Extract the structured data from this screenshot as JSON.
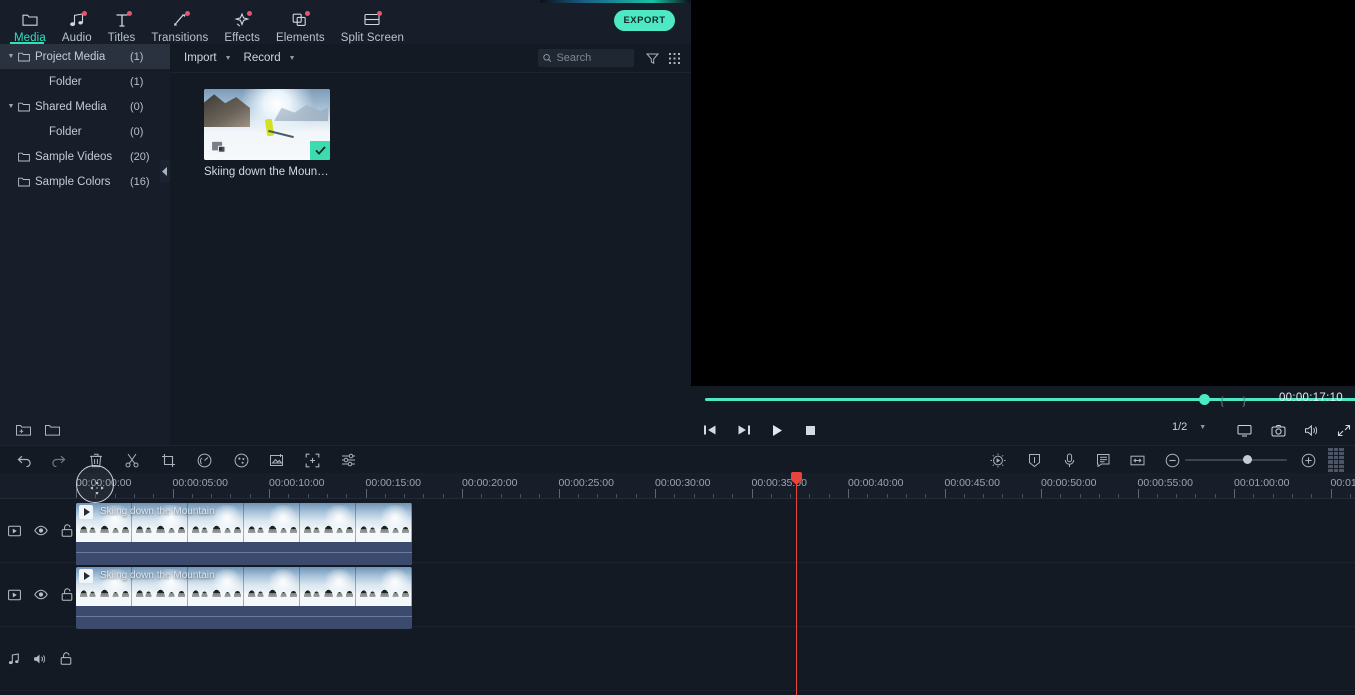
{
  "nav": {
    "items": [
      {
        "label": "Media",
        "icon": "folder-icon",
        "active": true,
        "dot": false
      },
      {
        "label": "Audio",
        "icon": "music-note-icon",
        "active": false,
        "dot": true
      },
      {
        "label": "Titles",
        "icon": "text-t-icon",
        "active": false,
        "dot": true
      },
      {
        "label": "Transitions",
        "icon": "transition-icon",
        "active": false,
        "dot": true
      },
      {
        "label": "Effects",
        "icon": "sparkle-star-icon",
        "active": false,
        "dot": true
      },
      {
        "label": "Elements",
        "icon": "shapes-icon",
        "active": false,
        "dot": true
      },
      {
        "label": "Split Screen",
        "icon": "split-screen-icon",
        "active": false,
        "dot": true
      }
    ]
  },
  "export": {
    "label": "EXPORT"
  },
  "library": {
    "tree": [
      {
        "label": "Project Media",
        "count": "(1)",
        "caret": "▼",
        "indent": false,
        "selected": true
      },
      {
        "label": "Folder",
        "count": "(1)",
        "caret": "",
        "indent": true,
        "selected": false
      },
      {
        "label": "Shared Media",
        "count": "(0)",
        "caret": "▼",
        "indent": false,
        "selected": false
      },
      {
        "label": "Folder",
        "count": "(0)",
        "caret": "",
        "indent": true,
        "selected": false
      },
      {
        "label": "Sample Videos",
        "count": "(20)",
        "caret": "",
        "indent": false,
        "selected": false
      },
      {
        "label": "Sample Colors",
        "count": "(16)",
        "caret": "",
        "indent": false,
        "selected": false
      }
    ],
    "footer_icons": [
      "new-folder-icon",
      "open-folder-icon"
    ],
    "collapse_icon": "collapse-panel-icon"
  },
  "media_toolbar": {
    "import_label": "Import",
    "record_label": "Record",
    "search_placeholder": "Search",
    "search_value": "",
    "filter_icon": "filter-funnel-icon",
    "view_icon": "grid-view-icon"
  },
  "media_items": [
    {
      "name": "Skiing down the Mountain",
      "selected": true,
      "badge": "pip-icon"
    }
  ],
  "player": {
    "timecode": "00:00:17:10",
    "progress_percent": 100,
    "mark_in": "{",
    "mark_out": "}",
    "ratio_label": "1/2",
    "controls": [
      {
        "name": "prev-frame-button",
        "icon": "prev-frame-icon"
      },
      {
        "name": "next-frame-button",
        "icon": "next-frame-icon"
      },
      {
        "name": "play-button",
        "icon": "play-icon"
      },
      {
        "name": "stop-button",
        "icon": "stop-icon"
      }
    ],
    "right_controls": [
      {
        "name": "display-settings-button",
        "icon": "monitor-icon"
      },
      {
        "name": "snapshot-button",
        "icon": "camera-icon"
      },
      {
        "name": "volume-button",
        "icon": "speaker-icon"
      },
      {
        "name": "fullscreen-button",
        "icon": "expand-arrows-icon"
      }
    ]
  },
  "timeline_toolbar": {
    "left_icons": [
      {
        "name": "undo-button",
        "icon": "undo-arrow-icon"
      },
      {
        "name": "redo-button",
        "icon": "redo-arrow-icon"
      },
      {
        "name": "delete-button",
        "icon": "trash-icon"
      },
      {
        "name": "split-button",
        "icon": "scissors-icon"
      },
      {
        "name": "crop-button",
        "icon": "crop-icon"
      },
      {
        "name": "speed-button",
        "icon": "speedometer-icon"
      },
      {
        "name": "color-button",
        "icon": "palette-icon"
      },
      {
        "name": "green-screen-button",
        "icon": "chroma-key-icon"
      },
      {
        "name": "motion-tracking-button",
        "icon": "tracking-box-icon"
      },
      {
        "name": "audio-mixer-button",
        "icon": "sliders-icon"
      }
    ],
    "right_icons": [
      {
        "name": "auto-enhance-button",
        "icon": "magic-wand-icon"
      },
      {
        "name": "mask-button",
        "icon": "shield-mask-icon"
      },
      {
        "name": "voiceover-button",
        "icon": "microphone-icon"
      },
      {
        "name": "auto-caption-button",
        "icon": "subtitle-icon"
      },
      {
        "name": "fit-timeline-button",
        "icon": "fit-width-icon"
      },
      {
        "name": "zoom-out-button",
        "icon": "minus-circle-icon"
      },
      {
        "name": "zoom-in-button",
        "icon": "plus-circle-icon"
      }
    ],
    "zoom_percent": 57,
    "drag_handle_icon": "grid-drag-handle-icon"
  },
  "timeline": {
    "ruler_ticks": [
      "00:00:00:00",
      "00:00:05:00",
      "00:00:10:00",
      "00:00:15:00",
      "00:00:20:00",
      "00:00:25:00",
      "00:00:30:00",
      "00:00:35:00",
      "00:00:40:00",
      "00:00:45:00",
      "00:00:50:00",
      "00:00:55:00",
      "00:01:00:00",
      "00:01"
    ],
    "playhead_time": "00:00:35:00",
    "tracks": [
      {
        "type": "video",
        "controls": [
          {
            "name": "track-type-video-icon",
            "icon": "video-track-icon"
          },
          {
            "name": "track-visibility-toggle",
            "icon": "eye-icon"
          },
          {
            "name": "track-lock-toggle",
            "icon": "unlock-icon"
          }
        ],
        "clip": {
          "label": "Skiing down the Mountain",
          "selected": true
        }
      },
      {
        "type": "video",
        "controls": [
          {
            "name": "track-type-video-icon",
            "icon": "video-track-icon"
          },
          {
            "name": "track-visibility-toggle",
            "icon": "eye-icon"
          },
          {
            "name": "track-lock-toggle",
            "icon": "unlock-icon"
          }
        ],
        "clip": {
          "label": "Skiing down the Mountain",
          "selected": false
        }
      },
      {
        "type": "audio",
        "controls": [
          {
            "name": "track-type-audio-icon",
            "icon": "music-track-icon"
          },
          {
            "name": "track-mute-toggle",
            "icon": "speaker-icon"
          },
          {
            "name": "track-lock-toggle",
            "icon": "unlock-icon"
          }
        ],
        "clip": null
      }
    ]
  },
  "colors": {
    "accent": "#4fe8c4",
    "playhead": "#e8443c",
    "panel_bg": "#171e29",
    "app_bg": "#141a23",
    "badge_dot": "#e8546b"
  }
}
